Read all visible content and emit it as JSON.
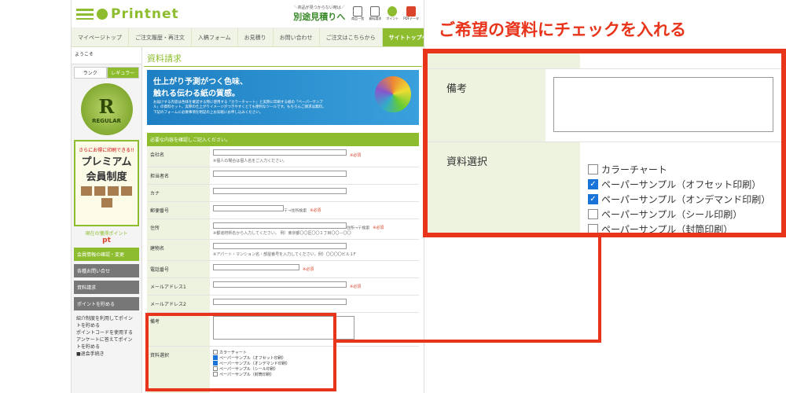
{
  "header": {
    "logo_text": "Printnet",
    "estimate_small": "＼商品が見つからない時は／",
    "estimate_big": "別途見積りへ",
    "icons": [
      {
        "name": "list-icon",
        "label": "商品一覧"
      },
      {
        "name": "document-icon",
        "label": "資料請求"
      },
      {
        "name": "point-icon",
        "label": "ポイント"
      },
      {
        "name": "pdf-icon",
        "label": "PDFデータ"
      }
    ]
  },
  "nav": [
    "マイページトップ",
    "ご注文履歴・再注文",
    "入稿フォーム",
    "お見積り",
    "お問い合わせ",
    "ご注文はこちらから",
    "サイトトップへ"
  ],
  "sidebar": {
    "welcome": "ようこそ",
    "rank_tabs": [
      "ランク",
      "レギュラー"
    ],
    "badge_letter": "R",
    "badge_label": "REGULAR",
    "premium_small": "さらにお得に印刷できる!!",
    "premium_line1": "プレミアム",
    "premium_line2": "会員制度",
    "points_label": "現在の獲得ポイント",
    "points_unit": "pt",
    "buttons": [
      "会員情報の確認・変更",
      "各種お問い合せ",
      "資料請求"
    ],
    "point_header": "ポイントを貯める",
    "point_items": [
      "紹介制度を利用してポイントを貯める",
      "ポイントコードを使用する",
      "アンケートに答えてポイントを貯める"
    ],
    "withdraw": "■退会手続き"
  },
  "main": {
    "title": "資料請求",
    "banner_line1": "仕上がり予測がつく色味、",
    "banner_line2": "触れる伝わる紙の質感。",
    "banner_text": "お届けする内容は色味を確認する際に使用する「カラーチャート」と実際に印刷する紙の「ペーパーサンプル」の資料セット。実際の仕上がりイメージがつきやすくとても便利なツールです。もちろんご請求は無料。下記のフォームに必要事項を明記の上お気軽にお申し込みください。",
    "form_header": "必要な内容を確認しご記入ください。",
    "required": "※必須",
    "fields": [
      {
        "label": "会社名",
        "note": "※個人の場合は個人名をご入力ください。",
        "required": true
      },
      {
        "label": "担当者名",
        "note": "",
        "required": false
      },
      {
        "label": "カナ",
        "note": "",
        "required": false
      },
      {
        "label": "郵便番号",
        "note": "",
        "required": true
      },
      {
        "label": "住所",
        "note": "※都道府県名から入力してください。 例）東京都〇〇区〇〇１丁目〇〇－〇〇",
        "required": true
      },
      {
        "label": "建物名",
        "note": "※アパート・マンション名・部屋番号を入力してください。例）〇〇〇〇ビル１F",
        "required": false
      },
      {
        "label": "電話番号",
        "note": "",
        "required": true
      },
      {
        "label": "メールアドレス1",
        "note": "",
        "required": true
      },
      {
        "label": "メールアドレス2",
        "note": "",
        "required": false
      },
      {
        "label": "備考",
        "note": "",
        "required": false
      }
    ],
    "zip_button": "〒→住所検索",
    "addr_button": "住所→〒検索"
  },
  "callout": {
    "title": "ご希望の資料にチェックを入れる",
    "remarks_label": "備考",
    "select_label": "資料選択",
    "options": [
      {
        "label": "カラーチャート",
        "checked": false
      },
      {
        "label": "ペーパーサンプル（オフセット印刷）",
        "checked": true
      },
      {
        "label": "ペーパーサンプル（オンデマンド印刷）",
        "checked": true
      },
      {
        "label": "ペーパーサンプル（シール印刷）",
        "checked": false
      },
      {
        "label": "ペーパーサンプル（封筒印刷）",
        "checked": false
      }
    ]
  },
  "colors": {
    "brand": "#8dbd2e",
    "highlight": "#e8341b",
    "check": "#1a73d9"
  }
}
